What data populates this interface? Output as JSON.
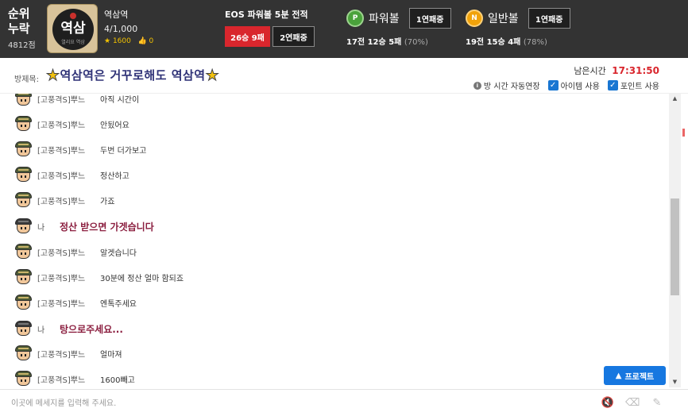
{
  "header": {
    "rank_label": "순위\n누락",
    "rank_line1": "순위",
    "rank_line2": "누락",
    "points": "4812점",
    "logo_text": "역삼",
    "logo_sub": "열리요 역삼",
    "room_name": "역삼역",
    "member_count": "4/1,000",
    "stars": "1600",
    "likes": "0"
  },
  "eos": {
    "title": "EOS 파워볼 5분 전적",
    "record_button": "26승 9패",
    "streak_button": "2연패중"
  },
  "powerball": {
    "badge": "P",
    "name": "파워볼",
    "streak": "1연패중",
    "record": "17전 12승 5패",
    "percent": "(70%)"
  },
  "normalball": {
    "badge": "N",
    "name": "일반볼",
    "streak": "1연패중",
    "record": "19전 15승 4패",
    "percent": "(78%)"
  },
  "titlebar": {
    "label": "방제목:",
    "star_left": "★",
    "title": "역삼역은 거꾸로해도 역삼역",
    "star_right": "★",
    "remain_label": "남은시간",
    "remain_time": "17:31:50",
    "opt_extend": "방 시간 자동연장",
    "opt_item": "아이템 사용",
    "opt_point": "포인트 사용"
  },
  "messages": [
    {
      "nick": "[고풍격S]뿌느",
      "text": "아직 시간이",
      "me": false
    },
    {
      "nick": "[고풍격S]뿌느",
      "text": "안됬어요",
      "me": false
    },
    {
      "nick": "[고풍격S]뿌느",
      "text": "두번 더가보고",
      "me": false
    },
    {
      "nick": "[고풍격S]뿌느",
      "text": "정산하고",
      "me": false
    },
    {
      "nick": "[고풍격S]뿌느",
      "text": "가죠",
      "me": false
    },
    {
      "nick": "나",
      "text": "정산 받으면 가겟습니다",
      "me": true
    },
    {
      "nick": "[고풍격S]뿌느",
      "text": "알겟습니다",
      "me": false
    },
    {
      "nick": "[고풍격S]뿌느",
      "text": "30분에 정산 얼마 함되죠",
      "me": false
    },
    {
      "nick": "[고풍격S]뿌느",
      "text": "엔톡주세요",
      "me": false
    },
    {
      "nick": "나",
      "text": "탕으로주세요...",
      "me": true
    },
    {
      "nick": "[고풍격S]뿌느",
      "text": "얼마져",
      "me": false
    },
    {
      "nick": "[고풍격S]뿌느",
      "text": "1600빼고",
      "me": false
    }
  ],
  "protect_button": "프로젝트",
  "input": {
    "placeholder": "이곳에 메세지를 입력해 주세요.",
    "value": ""
  },
  "icons": {
    "mute": "speaker-mute-icon",
    "eraser": "eraser-icon",
    "magic": "magic-wand-icon"
  }
}
